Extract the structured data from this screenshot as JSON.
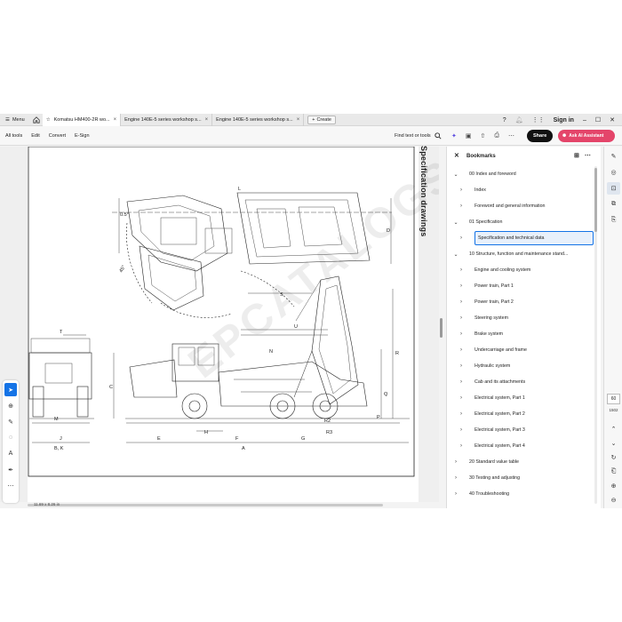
{
  "tabbar": {
    "menu_label": "Menu",
    "tabs": [
      {
        "label": "Komatsu HM400-2R wo...",
        "active": true
      },
      {
        "label": "Engine 140E-5 series workshop s...",
        "active": false
      },
      {
        "label": "Engine 140E-5 series workshop s...",
        "active": false
      }
    ],
    "create_label": "Create",
    "sign_in": "Sign in"
  },
  "toolbar": {
    "menu": [
      "All tools",
      "Edit",
      "Convert",
      "E-Sign"
    ],
    "find_label": "Find text or tools",
    "share_label": "Share",
    "ai_label": "Ask AI Assistant"
  },
  "document": {
    "page_title": "Specification drawings",
    "page_size": "11.69 x 8.26 in",
    "watermark": "EPCATALOGS",
    "labels": [
      "D",
      "L",
      "S",
      "T",
      "U",
      "N",
      "R",
      "C",
      "Q",
      "P",
      "M",
      "H",
      "R3",
      "R2",
      "J",
      "E",
      "F",
      "G",
      "B, K",
      "A",
      "0.5°",
      "45°"
    ]
  },
  "bookmarks": {
    "title": "Bookmarks",
    "items": [
      {
        "label": "00 Index and foreword",
        "level": 0,
        "chevron": "down",
        "selected": false
      },
      {
        "label": "Index",
        "level": 1,
        "chevron": "right",
        "selected": false
      },
      {
        "label": "Foreword and general information",
        "level": 1,
        "chevron": "right",
        "selected": false
      },
      {
        "label": "01 Specification",
        "level": 0,
        "chevron": "down",
        "selected": false
      },
      {
        "label": "Specification and technical data",
        "level": 1,
        "chevron": "right",
        "selected": true
      },
      {
        "label": "10 Structure, function and maintenance stand...",
        "level": 0,
        "chevron": "down",
        "selected": false
      },
      {
        "label": "Engine and cooling system",
        "level": 1,
        "chevron": "right",
        "selected": false
      },
      {
        "label": "Power train, Part 1",
        "level": 1,
        "chevron": "right",
        "selected": false
      },
      {
        "label": "Power train, Part 2",
        "level": 1,
        "chevron": "right",
        "selected": false
      },
      {
        "label": "Steering system",
        "level": 1,
        "chevron": "right",
        "selected": false
      },
      {
        "label": "Brake system",
        "level": 1,
        "chevron": "right",
        "selected": false
      },
      {
        "label": "Undercarriage and frame",
        "level": 1,
        "chevron": "right",
        "selected": false
      },
      {
        "label": "Hydraulic system",
        "level": 1,
        "chevron": "right",
        "selected": false
      },
      {
        "label": "Cab and its attachments",
        "level": 1,
        "chevron": "right",
        "selected": false
      },
      {
        "label": "Electrical system, Part 1",
        "level": 1,
        "chevron": "right",
        "selected": false
      },
      {
        "label": "Electrical system, Part 2",
        "level": 1,
        "chevron": "right",
        "selected": false
      },
      {
        "label": "Electrical system, Part 3",
        "level": 1,
        "chevron": "right",
        "selected": false
      },
      {
        "label": "Electrical system, Part 4",
        "level": 1,
        "chevron": "right",
        "selected": false
      },
      {
        "label": "20 Standard value table",
        "level": 0,
        "chevron": "right",
        "selected": false
      },
      {
        "label": "30 Testing and adjusting",
        "level": 0,
        "chevron": "right",
        "selected": false
      },
      {
        "label": "40 Troubleshooting",
        "level": 0,
        "chevron": "right",
        "selected": false
      }
    ]
  },
  "page_nav": {
    "current": "60",
    "total": "1502"
  },
  "colors": {
    "accent": "#1473e6",
    "share_bg": "#111111",
    "ai_bg": "#e4456a"
  }
}
